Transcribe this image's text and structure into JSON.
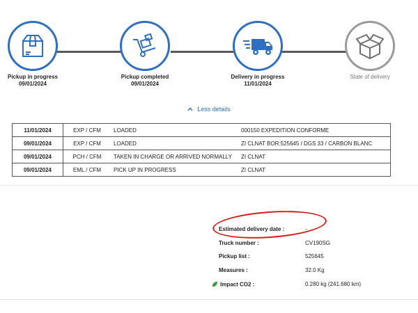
{
  "steps": [
    {
      "label": "Pickup in progress",
      "date": "09/01/2024",
      "icon": "package-box-icon",
      "state": "done"
    },
    {
      "label": "Pickup completed",
      "date": "09/01/2024",
      "icon": "hand-truck-icon",
      "state": "done"
    },
    {
      "label": "Delivery in progress",
      "date": "11/01/2024",
      "icon": "delivery-truck-icon",
      "state": "done"
    },
    {
      "label": "State of delivery",
      "date": "",
      "icon": "open-box-icon",
      "state": "pending"
    }
  ],
  "less_details": "Less details",
  "history": [
    {
      "date": "11/01/2024",
      "code": "EXP / CFM",
      "status": "LOADED",
      "info": "000150 EXPEDITION CONFORME"
    },
    {
      "date": "09/01/2024",
      "code": "EXP / CFM",
      "status": "LOADED",
      "info": "ZI CLNAT BOR:525645 / DGS 33 / CARBON BLANC"
    },
    {
      "date": "09/01/2024",
      "code": "PCH / CFM",
      "status": "TAKEN IN CHARGE OR ARRIVED NORMALLY",
      "info": "ZI CLNAT"
    },
    {
      "date": "09/01/2024",
      "code": "EML / CFM",
      "status": "PICK UP IN PROGRESS",
      "info": "ZI CLNAT"
    }
  ],
  "details": {
    "estimated_label": "Estimated delivery date :",
    "estimated_value": "-",
    "truck_label": "Truck number :",
    "truck_value": "CV190SG",
    "pickup_label": "Pickup list :",
    "pickup_value": "525645",
    "measures_label": "Measures :",
    "measures_value": "32.0 Kg",
    "co2_label": "Impact CO2 :",
    "co2_value": "0.280 kg (241.680 km)",
    "co2_icon": "leaf-icon"
  },
  "colors": {
    "accent": "#2d6fc0",
    "annotation": "#d81c1c",
    "pending": "#9a9a9a"
  }
}
